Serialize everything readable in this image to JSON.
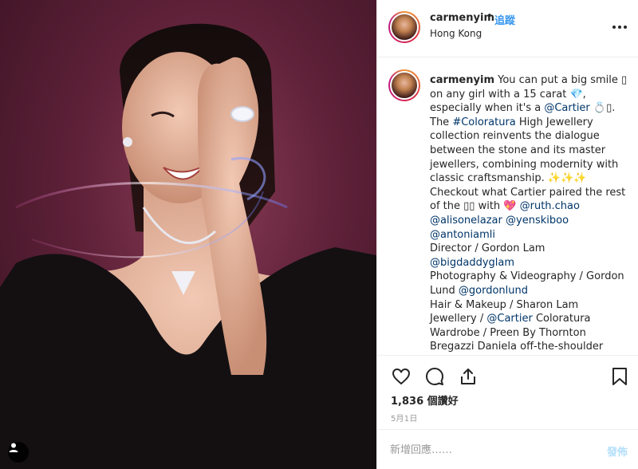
{
  "post": {
    "username": "carmenyim",
    "separator": "•",
    "follow_label": "追蹤",
    "location": "Hong Kong"
  },
  "caption": {
    "username": "carmenyim",
    "lines": [
      "You can put a big smile ▯",
      "on any girl with a 15 carat 💎,",
      "especially when it's a ",
      "The ",
      "collection reinvents the dialogue",
      "between the stone and its master",
      "jewellers, combining modernity with",
      "classic craftsmanship. ✨✨✨",
      "Checkout what Cartier paired the rest",
      "of the ▯▯ with 💖 ",
      "",
      "",
      "Director / Gordon Lam",
      "",
      "Photography & Videography / Gordon",
      "Lund ",
      "Hair & Makeup / Sharon Lam",
      "Jewellery / ",
      "Wardrobe / Preen By Thornton",
      "Bregazzi Daniela off-the-shoulder"
    ],
    "mention_cartier": "@Cartier",
    "ring_emoji": " 💍▯.",
    "hashtag_coloratura": "#Coloratura",
    "text_high_jewellery": " High Jewellery",
    "mention_ruth": "@ruth.chao",
    "mention_alisonelazar": "@alisonelazar",
    "mention_yenskiboo": "@yenskiboo",
    "mention_antoniamli": "@antoniamli",
    "mention_bigdaddyglam": "@bigdaddyglam",
    "mention_gordonlund": "@gordonlund",
    "mention_cartier_2": "@Cartier",
    "text_coloratura": " Coloratura"
  },
  "actions": {
    "likes": "1,836 個讚好",
    "date": "5月1日"
  },
  "comment": {
    "placeholder": "新增回應……",
    "post_label": "發佈"
  },
  "icons": {
    "more": "more-options-icon",
    "like": "heart-icon",
    "comment": "comment-icon",
    "share": "share-icon",
    "save": "bookmark-icon",
    "user_tag": "user-tag-icon"
  },
  "colors": {
    "link": "#003569",
    "follow": "#3897f0",
    "post_disabled": "#b2dffc"
  }
}
